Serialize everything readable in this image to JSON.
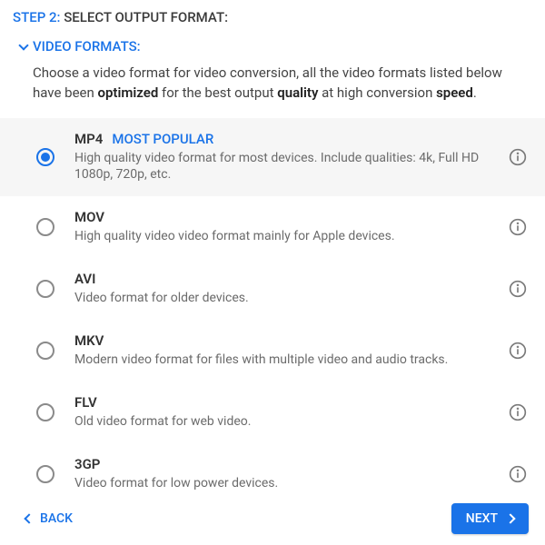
{
  "header": {
    "step_label": "STEP 2:",
    "title": "SELECT OUTPUT FORMAT:"
  },
  "section": {
    "title": "VIDEO FORMATS:"
  },
  "description": {
    "pre": "Choose a video format for video conversion, all the video formats listed below have been ",
    "b1": "optimized",
    "mid": " for the best output ",
    "b2": "quality",
    "mid2": " at high conversion ",
    "b3": "speed",
    "post": "."
  },
  "formats": [
    {
      "name": "MP4",
      "badge": "MOST POPULAR",
      "desc": "High quality video format for most devices. Include qualities: 4k, Full HD 1080p, 720p, etc.",
      "selected": true
    },
    {
      "name": "MOV",
      "badge": "",
      "desc": "High quality video video format mainly for Apple devices.",
      "selected": false
    },
    {
      "name": "AVI",
      "badge": "",
      "desc": "Video format for older devices.",
      "selected": false
    },
    {
      "name": "MKV",
      "badge": "",
      "desc": "Modern video format for files with multiple video and audio tracks.",
      "selected": false
    },
    {
      "name": "FLV",
      "badge": "",
      "desc": "Old video format for web video.",
      "selected": false
    },
    {
      "name": "3GP",
      "badge": "",
      "desc": "Video format for low power devices.",
      "selected": false
    }
  ],
  "footer": {
    "back": "BACK",
    "next": "NEXT"
  }
}
